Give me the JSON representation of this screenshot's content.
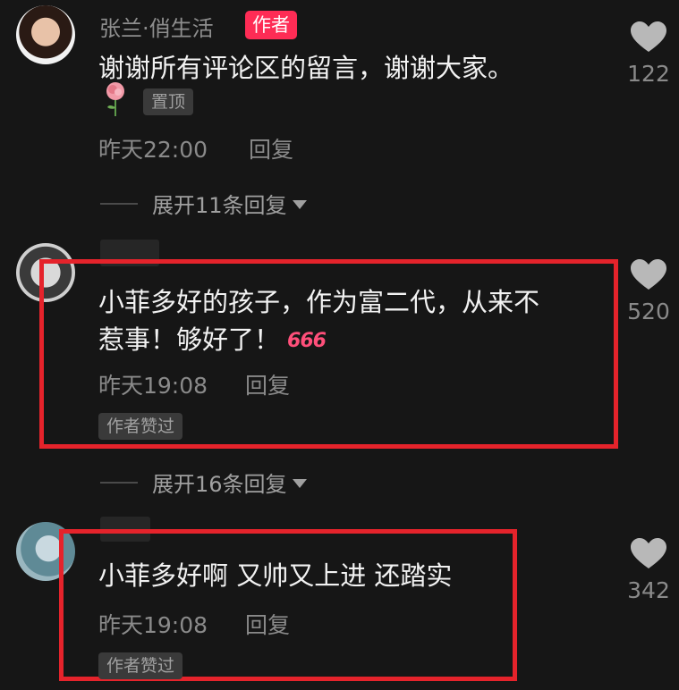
{
  "comments": [
    {
      "username": "张兰·俏生活",
      "author_badge": "作者",
      "text": "谢谢所有评论区的留言，谢谢大家。",
      "pinned_label": "置顶",
      "time": "昨天22:00",
      "reply": "回复",
      "likes": "122",
      "expand": "展开11条回复"
    },
    {
      "text_line1": "小菲多好的孩子，作为富二代，从来不",
      "text_line2": "惹事！够好了！",
      "emoji": "666",
      "time": "昨天19:08",
      "reply": "回复",
      "tag": "作者赞过",
      "likes": "520",
      "expand": "展开16条回复"
    },
    {
      "text": "小菲多好啊 又帅又上进 还踏实",
      "time": "昨天19:08",
      "reply": "回复",
      "tag": "作者赞过",
      "likes": "342"
    }
  ],
  "icons": {
    "like": "heart-icon",
    "expand": "caret-down-icon",
    "pinned_decoration": "rose-icon"
  },
  "colors": {
    "background": "#161616",
    "author_badge": "#fe2c55",
    "highlight": "#e5232b",
    "muted_text": "#8a8a8a"
  }
}
